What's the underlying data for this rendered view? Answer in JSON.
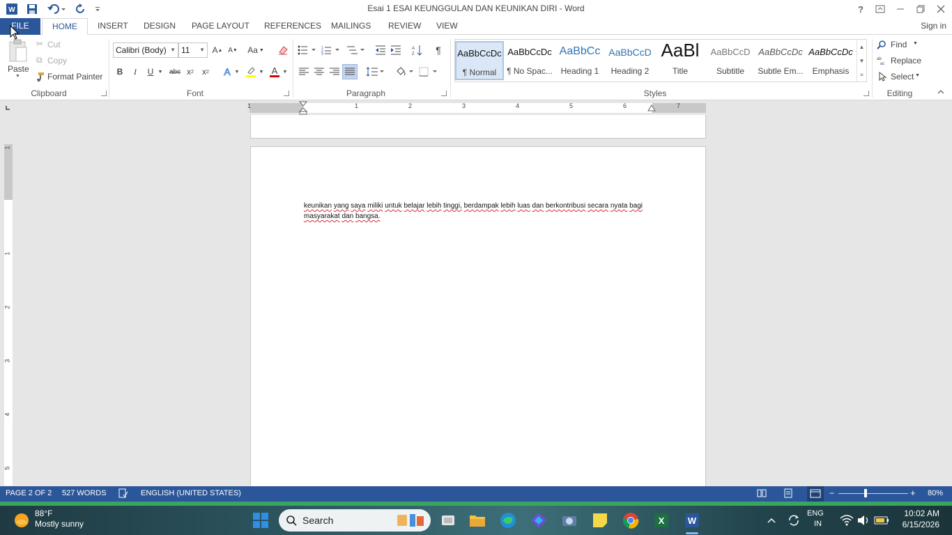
{
  "window": {
    "title": "Esai 1 ESAI KEUNGGULAN DAN KEUNIKAN DIRI - Word",
    "help": "?",
    "sign_in": "Sign in"
  },
  "tabs": [
    {
      "label": "FILE"
    },
    {
      "label": "HOME"
    },
    {
      "label": "INSERT"
    },
    {
      "label": "DESIGN"
    },
    {
      "label": "PAGE LAYOUT"
    },
    {
      "label": "REFERENCES"
    },
    {
      "label": "MAILINGS"
    },
    {
      "label": "REVIEW"
    },
    {
      "label": "VIEW"
    }
  ],
  "clipboard": {
    "paste": "Paste",
    "cut": "Cut",
    "copy": "Copy",
    "format_painter": "Format Painter",
    "group": "Clipboard"
  },
  "font": {
    "name": "Calibri (Body)",
    "size": "11",
    "change_case": "Aa",
    "bold": "B",
    "italic": "I",
    "underline": "U",
    "strike": "abc",
    "subscript": "x",
    "superscript": "x",
    "group": "Font",
    "highlight_color": "#ffff00",
    "font_color": "#e00000"
  },
  "paragraph": {
    "group": "Paragraph",
    "show_marks": "¶"
  },
  "styles": {
    "group": "Styles",
    "items": [
      {
        "preview": "AaBbCcDc",
        "name": "¶ Normal"
      },
      {
        "preview": "AaBbCcDc",
        "name": "¶ No Spac..."
      },
      {
        "preview": "AaBbCc",
        "name": "Heading 1"
      },
      {
        "preview": "AaBbCcD",
        "name": "Heading 2"
      },
      {
        "preview": "AaBl",
        "name": "Title"
      },
      {
        "preview": "AaBbCcD",
        "name": "Subtitle"
      },
      {
        "preview": "AaBbCcDc",
        "name": "Subtle Em..."
      },
      {
        "preview": "AaBbCcDc",
        "name": "Emphasis"
      }
    ]
  },
  "editing": {
    "group": "Editing",
    "find": "Find",
    "replace": "Replace",
    "select": "Select"
  },
  "ruler": {
    "numbers": [
      "1",
      "1",
      "2",
      "3",
      "4",
      "5",
      "6",
      "7"
    ],
    "vertical_numbers": [
      "1",
      "1",
      "2",
      "3",
      "4",
      "5"
    ]
  },
  "document": {
    "words": [
      {
        "t": "keunikan",
        "err": true
      },
      {
        "t": " "
      },
      {
        "t": "yang",
        "err": true
      },
      {
        "t": " "
      },
      {
        "t": "saya",
        "err": true
      },
      {
        "t": " "
      },
      {
        "t": "miliki",
        "err": true
      },
      {
        "t": " "
      },
      {
        "t": "untuk",
        "err": true
      },
      {
        "t": " "
      },
      {
        "t": "belajar",
        "err": true
      },
      {
        "t": " "
      },
      {
        "t": "lebih",
        "err": true
      },
      {
        "t": " "
      },
      {
        "t": "tinggi,",
        "err": true
      },
      {
        "t": " "
      },
      {
        "t": "berdampak",
        "err": true
      },
      {
        "t": " "
      },
      {
        "t": "lebih",
        "err": true
      },
      {
        "t": " "
      },
      {
        "t": "luas",
        "err": true
      },
      {
        "t": " "
      },
      {
        "t": "dan",
        "err": true
      },
      {
        "t": " "
      },
      {
        "t": "berkontribusi",
        "err": true
      },
      {
        "t": " "
      },
      {
        "t": "secara",
        "err": true
      },
      {
        "t": " "
      },
      {
        "t": "nyata",
        "err": true
      },
      {
        "t": " "
      },
      {
        "t": "bagi",
        "err": true
      },
      {
        "t": " "
      },
      {
        "t": "masyarakat",
        "err": true
      },
      {
        "t": " "
      },
      {
        "t": "dan",
        "err": true
      },
      {
        "t": " "
      },
      {
        "t": "bangsa.",
        "err": true
      }
    ]
  },
  "status": {
    "page": "PAGE 2 OF 2",
    "words": "527 WORDS",
    "language": "ENGLISH (UNITED STATES)",
    "zoom": "80%",
    "zoom_level_percent": 80
  },
  "taskbar": {
    "temp": "88°F",
    "weather": "Mostly sunny",
    "search": "Search",
    "lang_top": "ENG",
    "lang_bottom": "IN",
    "time": "10:02 AM",
    "date": "6/15/2026"
  },
  "colors": {
    "accent": "#2b579a",
    "spell_error": "#d62c2c"
  }
}
